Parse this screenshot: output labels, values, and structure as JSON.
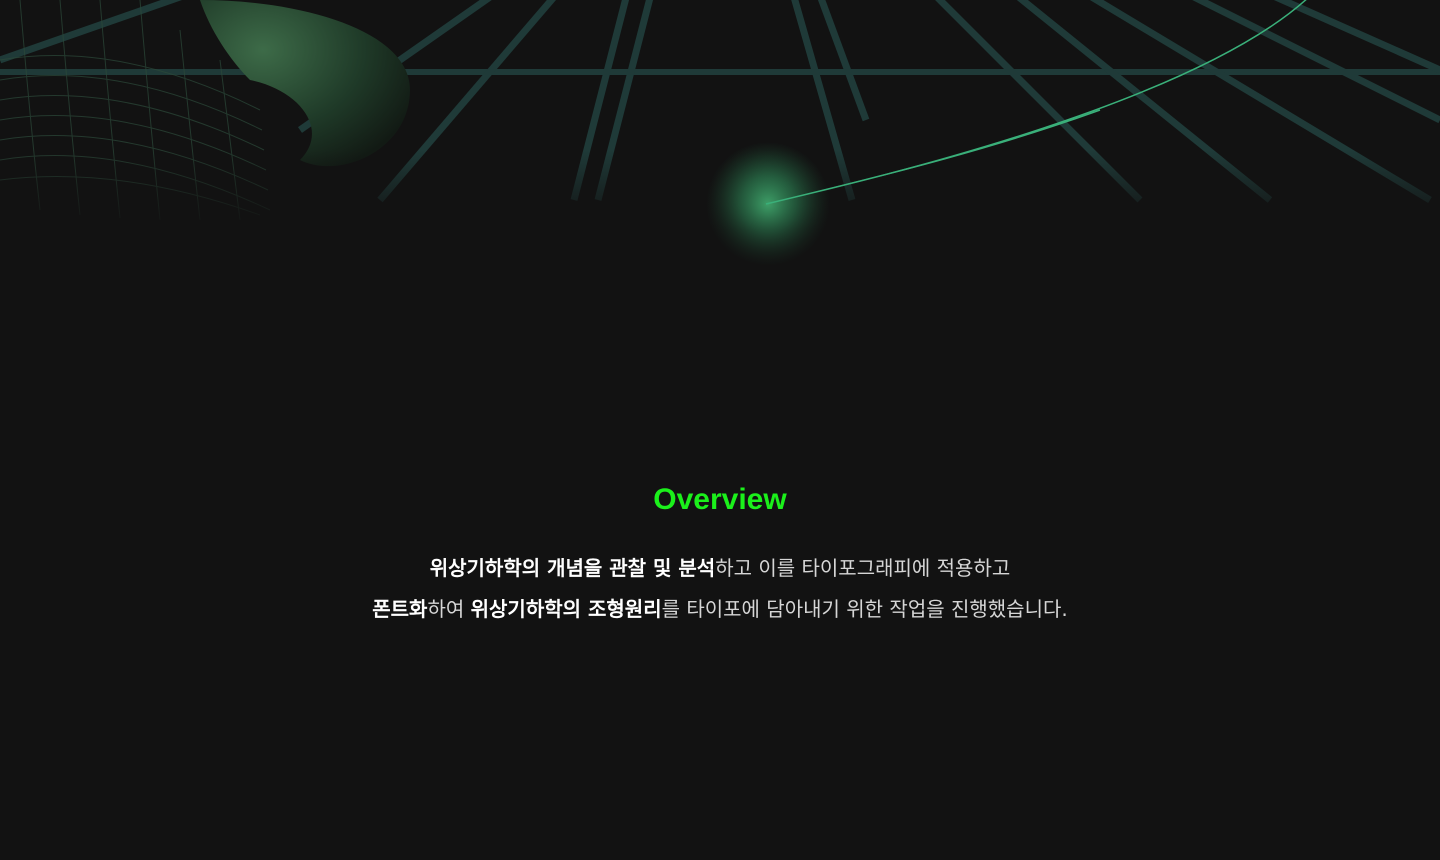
{
  "colors": {
    "background": "#121212",
    "accent": "#1bf01b",
    "grid_line": "#1f3a38",
    "curve": "#3ab07a",
    "glow": "#2f8a58",
    "torus": "#2a4a34"
  },
  "overview": {
    "title": "Overview",
    "lines": [
      [
        {
          "text": "위상기하학의 개념을 관찰 및 분석",
          "bold": true
        },
        {
          "text": "하고 이를 타이포그래피에 적용하고",
          "bold": false
        }
      ],
      [
        {
          "text": "폰트화",
          "bold": true
        },
        {
          "text": "하여 ",
          "bold": false
        },
        {
          "text": "위상기하학의 조형원리",
          "bold": true
        },
        {
          "text": "를 타이포에 담아내기 위한 작업을 진행했습니다.",
          "bold": false
        }
      ]
    ]
  }
}
